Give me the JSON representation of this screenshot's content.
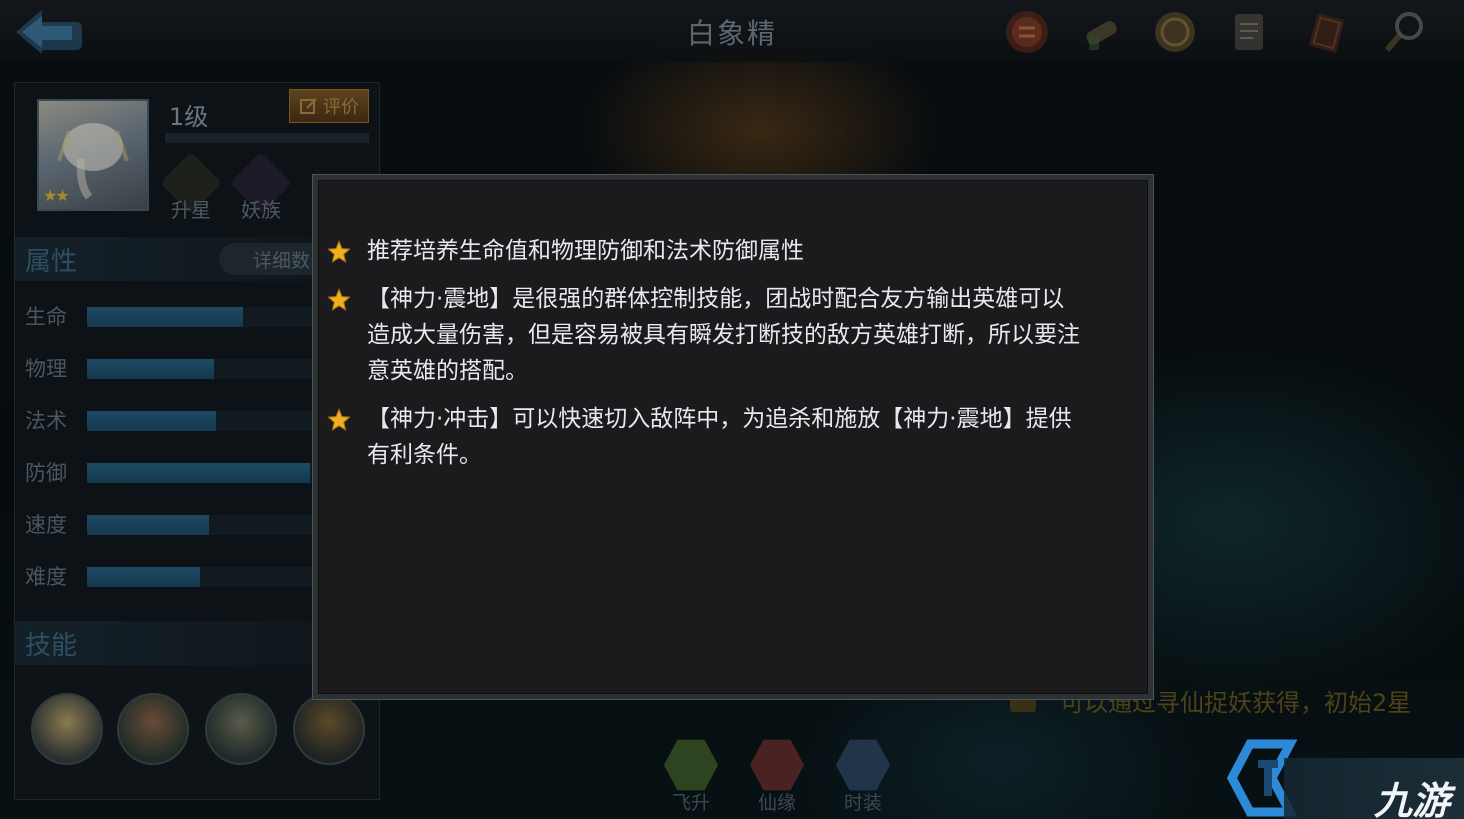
{
  "header": {
    "title": "白象精"
  },
  "top_icons": [
    "scroll-seal-icon",
    "rolled-scroll-icon",
    "coin-icon",
    "letter-icon",
    "book-icon",
    "magnifier-icon"
  ],
  "hero": {
    "level": "1级",
    "stars": 2,
    "rate_label": "评价",
    "badges": [
      {
        "label": "升星",
        "icon": "star-badge-icon"
      },
      {
        "label": "妖族",
        "icon": "demon-race-icon"
      }
    ]
  },
  "attributes": {
    "title": "属性",
    "detail_label": "详细数",
    "items": [
      {
        "label": "生命",
        "value": 0.68
      },
      {
        "label": "物理",
        "value": 0.55
      },
      {
        "label": "法术",
        "value": 0.56
      },
      {
        "label": "防御",
        "value": 0.97
      },
      {
        "label": "速度",
        "value": 0.53
      },
      {
        "label": "难度",
        "value": 0.49
      }
    ]
  },
  "skills": {
    "title": "技能",
    "icons": [
      "drum-skill-icon",
      "flower-skill-icon",
      "wind-skill-icon",
      "beast-skill-icon"
    ]
  },
  "bottom_tabs": [
    {
      "label": "飞升",
      "icon": "ascend-icon",
      "color": "#3f5a2a"
    },
    {
      "label": "仙缘",
      "icon": "fate-icon",
      "color": "#5a2a2a"
    },
    {
      "label": "时装",
      "icon": "costume-icon",
      "color": "#2a3f5a"
    }
  ],
  "background_notice": "可以通过寻仙捉妖获得，初始2星",
  "modal": {
    "tips": [
      "推荐培养生命值和物理防御和法术防御属性",
      "【神力·震地】是很强的群体控制技能，团战时配合友方输出英雄可以造成大量伤害，但是容易被具有瞬发打断技的敌方英雄打断，所以要注意英雄的搭配。",
      "【神力·冲击】可以快速切入敌阵中，为追杀和施放【神力·震地】提供有利条件。"
    ]
  },
  "watermark": {
    "text": "九游"
  },
  "colors": {
    "star": "#f0b020",
    "attr_fill": "#1d4a64",
    "modal_bg": "#1b1b1e"
  }
}
